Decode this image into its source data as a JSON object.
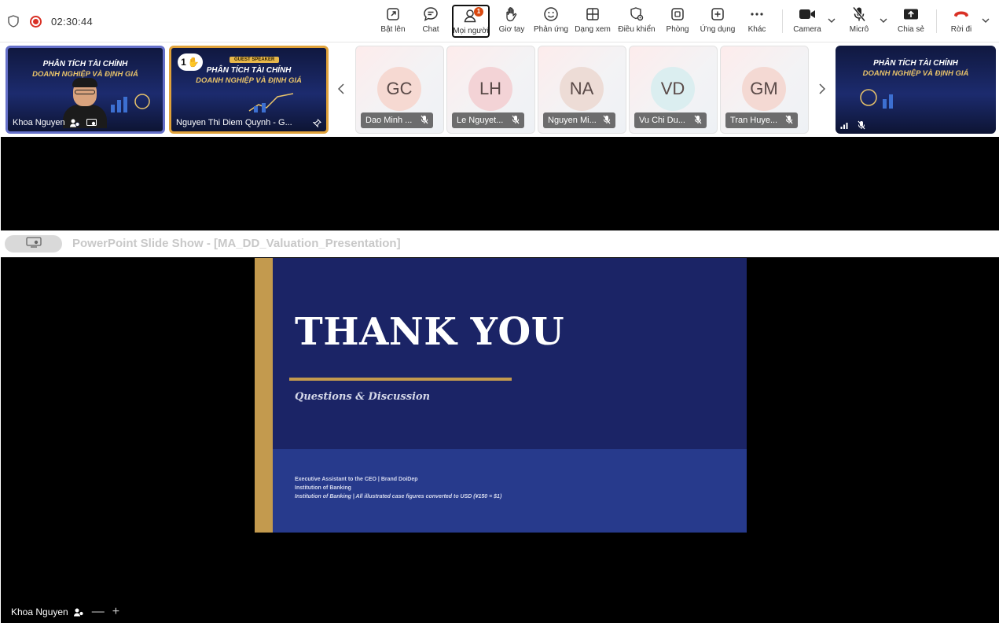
{
  "topbar": {
    "timer": "02:30:44",
    "buttons": {
      "raise_screen": "Bật lên",
      "chat": "Chat",
      "people": "Mọi người",
      "people_badge": "1",
      "hand": "Giơ tay",
      "react": "Phản ứng",
      "view": "Dạng xem",
      "control": "Điều khiển",
      "rooms": "Phòng",
      "apps": "Ứng dụng",
      "more": "Khác",
      "camera": "Camera",
      "mic": "Micrô",
      "share": "Chia sẻ",
      "leave": "Rời đi"
    }
  },
  "strip": {
    "tile1": {
      "name": "Khoa Nguyen",
      "promo_line1": "PHÂN TÍCH TÀI CHÍNH",
      "promo_line2": "DOANH NGHIỆP VÀ ĐỊNH GIÁ"
    },
    "tile2": {
      "name": "Nguyen Thi Diem Quynh - G...",
      "raised_hand_count": "1",
      "guest_tag": "GUEST SPEAKER",
      "promo_line1": "PHÂN TÍCH TÀI CHÍNH",
      "promo_line2": "DOANH NGHIỆP VÀ ĐỊNH GIÁ"
    },
    "avatars": [
      {
        "initials": "GC",
        "name": "Dao Minh ...",
        "color": "#f6d9d2"
      },
      {
        "initials": "LH",
        "name": "Le Nguyet...",
        "color": "#f3d3d6"
      },
      {
        "initials": "NA",
        "name": "Nguyen Mi...",
        "color": "#eddcd6"
      },
      {
        "initials": "VD",
        "name": "Vu Chi Du...",
        "color": "#dbeef0"
      },
      {
        "initials": "GM",
        "name": "Tran Huye...",
        "color": "#f4d9d3"
      }
    ],
    "tile_last": {
      "promo_line1": "PHÂN TÍCH TÀI CHÍNH",
      "promo_line2": "DOANH NGHIỆP VÀ ĐỊNH GIÁ"
    }
  },
  "share": {
    "window_title": "PowerPoint Slide Show - [MA_DD_Valuation_Presentation]"
  },
  "slide": {
    "title": "THANK YOU",
    "subtitle": "Questions & Discussion",
    "footer_line1": "Executive Assistant to the CEO | Brand DoiDep",
    "footer_line2": "Institution of Banking",
    "footer_line3": "Institution of Banking  |  All illustrated case figures converted to USD (¥150 = $1)",
    "colors": {
      "background": "#1b2466",
      "accent": "#c39a4e",
      "footer": "#273a8c"
    }
  },
  "bottombar": {
    "presenter": "Khoa Nguyen",
    "minimize": "—",
    "expand": "+"
  },
  "icons": {
    "security": "shield-icon",
    "recording": "record-icon",
    "leave_color": "#d93025"
  }
}
